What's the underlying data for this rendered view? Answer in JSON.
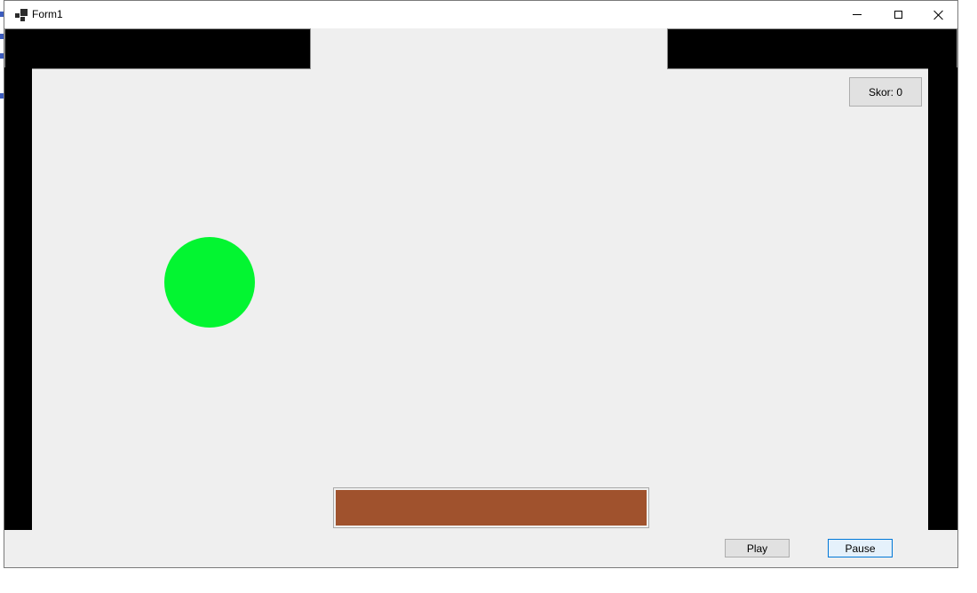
{
  "window": {
    "title": "Form1",
    "controls": {
      "minimize": "minimize",
      "maximize": "maximize",
      "close": "close"
    }
  },
  "game": {
    "score_label": "Skor: 0",
    "ball_color": "#03f531",
    "paddle_color": "#a0522d",
    "wall_color": "#000000",
    "background_color": "#efefef"
  },
  "buttons": {
    "play": "Play",
    "pause": "Pause"
  }
}
